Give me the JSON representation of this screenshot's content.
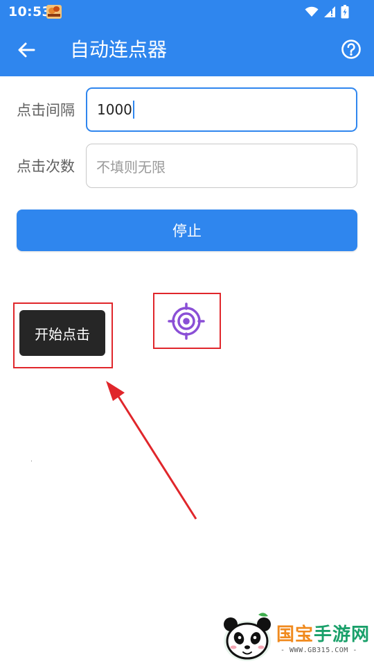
{
  "status_bar": {
    "time": "10:53",
    "icons": [
      "app-notification-icon",
      "wifi-icon",
      "signal-icon",
      "battery-icon"
    ]
  },
  "app_bar": {
    "title": "自动连点器",
    "back_icon": "arrow-left-icon",
    "help_icon": "help-circle-icon"
  },
  "form": {
    "interval": {
      "label": "点击间隔",
      "value": "1000"
    },
    "count": {
      "label": "点击次数",
      "value": "",
      "placeholder": "不填则无限"
    }
  },
  "stop_button": {
    "label": "停止"
  },
  "floating": {
    "start_button_label": "开始点击",
    "target_icon": "crosshair-target-icon"
  },
  "watermark": {
    "name_a": "国宝",
    "name_b": "手游网",
    "url": "- WWW.GB315.COM -"
  },
  "colors": {
    "primary": "#2f86ee",
    "highlight": "#e0262b",
    "target": "#8a4fd6",
    "dark_button": "#262626"
  }
}
